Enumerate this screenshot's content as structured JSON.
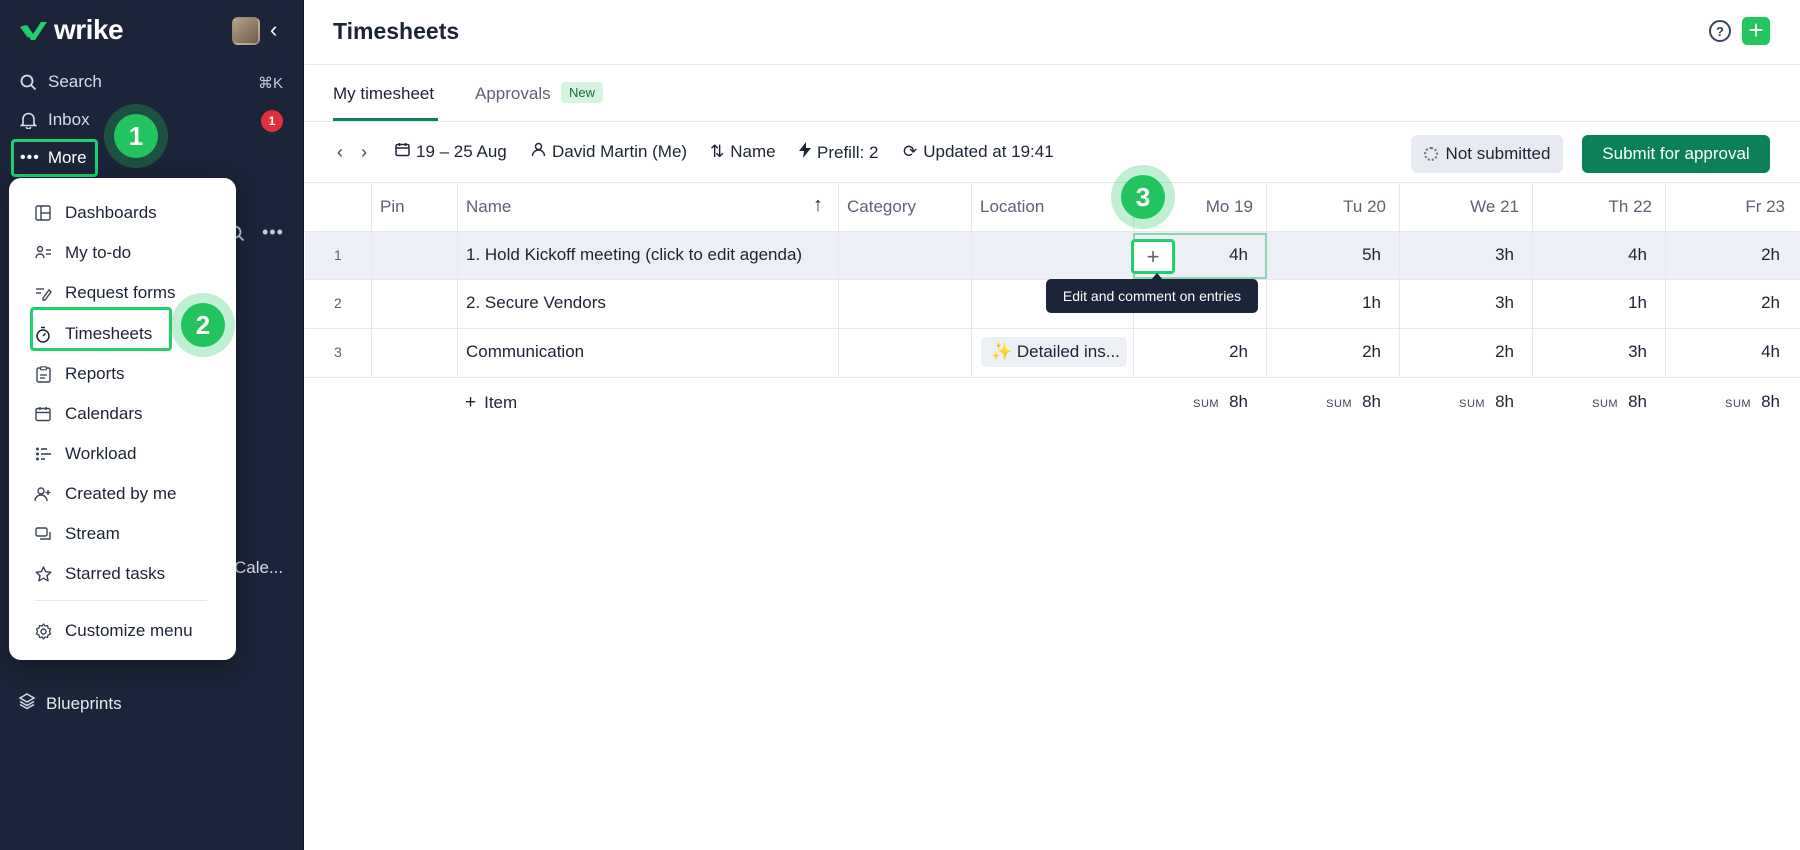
{
  "sidebar": {
    "logo": "wrike",
    "search": {
      "label": "Search",
      "shortcut": "⌘K"
    },
    "inbox": {
      "label": "Inbox",
      "badge": "1"
    },
    "more": {
      "label": "More"
    },
    "partial_text": "Cale...",
    "blueprints": "Blueprints"
  },
  "menu": {
    "items": [
      {
        "label": "Dashboards",
        "icon": "dashboard-icon"
      },
      {
        "label": "My to-do",
        "icon": "person-list-icon"
      },
      {
        "label": "Request forms",
        "icon": "form-edit-icon"
      },
      {
        "label": "Timesheets",
        "icon": "stopwatch-icon"
      },
      {
        "label": "Reports",
        "icon": "report-icon"
      },
      {
        "label": "Calendars",
        "icon": "calendar-icon"
      },
      {
        "label": "Workload",
        "icon": "workload-icon"
      },
      {
        "label": "Created by me",
        "icon": "person-plus-icon"
      },
      {
        "label": "Stream",
        "icon": "stream-icon"
      },
      {
        "label": "Starred tasks",
        "icon": "star-icon"
      }
    ],
    "customize": {
      "label": "Customize menu",
      "icon": "gear-icon"
    }
  },
  "callouts": [
    "1",
    "2",
    "3"
  ],
  "main": {
    "title": "Timesheets",
    "help": "?",
    "add": "+",
    "tabs": {
      "my_timesheet": "My timesheet",
      "approvals": "Approvals",
      "new_badge": "New"
    },
    "toolbar": {
      "date_range": "19 – 25 Aug",
      "user": "David Martin (Me)",
      "sort": "Name",
      "prefill": "Prefill: 2",
      "updated": "Updated at 19:41",
      "status": "Not submitted",
      "submit": "Submit for approval"
    },
    "table": {
      "headers": {
        "pin": "Pin",
        "name": "Name",
        "category": "Category",
        "location": "Location",
        "days": [
          "Mo 19",
          "Tu 20",
          "We 21",
          "Th 22",
          "Fr 23"
        ]
      },
      "rows": [
        {
          "num": "1",
          "name": "1. Hold Kickoff meeting (click to edit agenda)",
          "location": "",
          "hours": [
            "4h",
            "5h",
            "3h",
            "4h",
            "2h"
          ]
        },
        {
          "num": "2",
          "name": "2. Secure Vendors",
          "location": "",
          "hours": [
            "",
            "1h",
            "3h",
            "1h",
            "2h"
          ]
        },
        {
          "num": "3",
          "name": "Communication",
          "location": "✨ Detailed ins...",
          "hours": [
            "2h",
            "2h",
            "2h",
            "3h",
            "4h"
          ]
        }
      ],
      "add_item": "Item",
      "sum_label": "SUM",
      "sums": [
        "8h",
        "8h",
        "8h",
        "8h",
        "8h"
      ]
    },
    "tooltip": "Edit and comment on entries",
    "cell_plus": "+"
  },
  "colors": {
    "sidebar_bg": "#1b2438",
    "accent_green": "#0c7f5b",
    "callout_green": "#21c45d",
    "badge_red": "#e0303e"
  }
}
